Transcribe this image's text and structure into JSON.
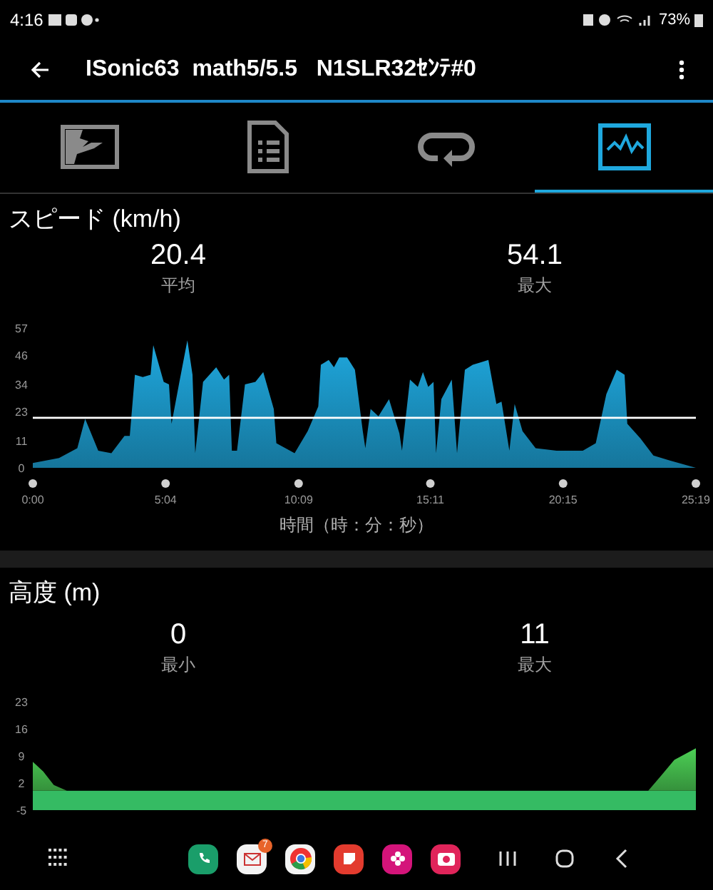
{
  "status_bar": {
    "time": "4:16",
    "battery": "73%"
  },
  "app_bar": {
    "title": "ISonic63  math5/5.5   N1SLR32ｾﾝﾃ#0"
  },
  "tabs": [
    {
      "kind": "map",
      "selected": false
    },
    {
      "kind": "document",
      "selected": false
    },
    {
      "kind": "loop",
      "selected": false
    },
    {
      "kind": "pulse",
      "selected": true
    }
  ],
  "speed": {
    "title": "スピード (km/h)",
    "stats": [
      {
        "value": "20.4",
        "label": "平均"
      },
      {
        "value": "54.1",
        "label": "最大"
      }
    ],
    "chart_data": {
      "type": "area",
      "xlabel": "時間（時：分：秒）",
      "x": [
        0,
        1,
        1.7,
        2,
        2.5,
        3,
        3.5,
        3.7,
        3.9,
        4.2,
        4.5,
        4.6,
        5,
        5.2,
        5.3,
        5.6,
        5.9,
        6.1,
        6.2,
        6.5,
        7,
        7.3,
        7.5,
        7.6,
        7.8,
        8.1,
        8.5,
        8.8,
        9.2,
        9.3,
        10,
        10.5,
        10.9,
        11,
        11.3,
        11.5,
        11.7,
        12,
        12.3,
        12.6,
        12.7,
        12.9,
        13.2,
        13.6,
        14,
        14.1,
        14.4,
        14.7,
        14.9,
        15.1,
        15.3,
        15.4,
        15.6,
        16,
        16.2,
        16.5,
        16.8,
        17.4,
        17.7,
        17.9,
        18.2,
        18.4,
        18.7,
        19.2,
        20,
        21,
        21.5,
        21.9,
        22.3,
        22.6,
        22.7,
        23.2,
        23.7,
        24.3,
        25.32
      ],
      "series": [
        {
          "color": "#1fa8de",
          "values": [
            2,
            4,
            8,
            20,
            7,
            6,
            13,
            13,
            38,
            37,
            38,
            50,
            35,
            34,
            18,
            35,
            52,
            38,
            6,
            35,
            41,
            36,
            38,
            7,
            7,
            34,
            35,
            39,
            24,
            10,
            6,
            15,
            25,
            42,
            44,
            41,
            45,
            45,
            40,
            15,
            8,
            24,
            21,
            28,
            14,
            7,
            36,
            33,
            39,
            33,
            35,
            6,
            28,
            36,
            6,
            40,
            42,
            44,
            26,
            27,
            7,
            26,
            15,
            8,
            7,
            7,
            10,
            30,
            40,
            38,
            18,
            12,
            5,
            3,
            0
          ]
        }
      ],
      "xlim": [
        0,
        25.32
      ],
      "ylim": [
        0,
        57
      ],
      "xticks": [
        {
          "value": 0,
          "label": "0:00"
        },
        {
          "value": 5.07,
          "label": "5:04"
        },
        {
          "value": 10.15,
          "label": "10:09"
        },
        {
          "value": 15.18,
          "label": "15:11"
        },
        {
          "value": 20.25,
          "label": "20:15"
        },
        {
          "value": 25.32,
          "label": "25:19"
        }
      ],
      "yticks": [
        0,
        11,
        23,
        34,
        46,
        57
      ],
      "ref_lines": [
        {
          "axis": "y",
          "value": 20.4
        }
      ]
    }
  },
  "altitude": {
    "title": "高度 (m)",
    "stats": [
      {
        "value": "0",
        "label": "最小"
      },
      {
        "value": "11",
        "label": "最大"
      }
    ],
    "chart_data": {
      "type": "area",
      "x": [
        0,
        0.4,
        0.8,
        1.3,
        23.5,
        24,
        24.5,
        25.32
      ],
      "series": [
        {
          "color": "#4ccf55",
          "values": [
            7.5,
            5,
            1.5,
            0,
            0,
            4,
            8,
            11
          ]
        }
      ],
      "xlim": [
        0,
        25.32
      ],
      "ylim": [
        -5,
        23
      ],
      "yticks": [
        -5,
        2,
        9,
        16,
        23
      ],
      "bands": [
        {
          "axis": "y",
          "from": -5,
          "to": 0,
          "color": "#35bb63"
        }
      ]
    }
  },
  "dock": {
    "mail_badge": "7"
  }
}
